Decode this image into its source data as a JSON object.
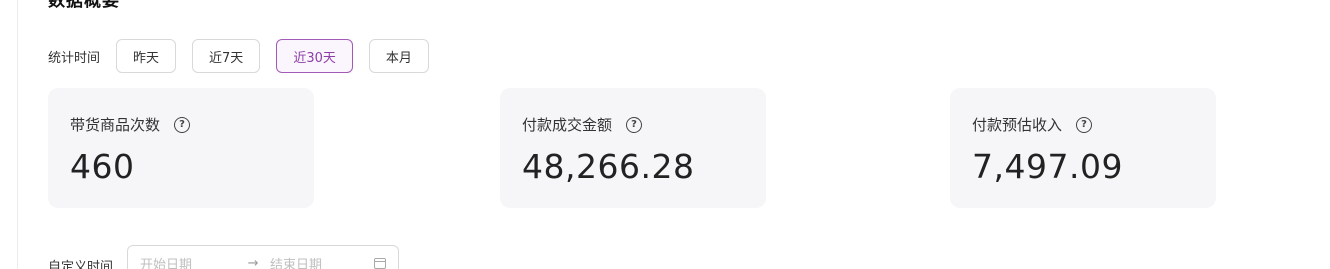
{
  "section": {
    "title": "数据概要"
  },
  "filter": {
    "label": "统计时间",
    "options": [
      "昨天",
      "近7天",
      "近30天",
      "本月"
    ],
    "selected": "近30天"
  },
  "cards": [
    {
      "title": "带货商品次数",
      "value": "460",
      "icon": "question-circle-icon"
    },
    {
      "title": "付款成交金额",
      "value": "48,266.28",
      "icon": "question-circle-icon"
    },
    {
      "title": "付款预估收入",
      "value": "7,497.09",
      "icon": "question-circle-icon"
    }
  ],
  "custom_range": {
    "label": "自定义时间",
    "start_placeholder": "开始日期",
    "separator": "→",
    "end_placeholder": "结束日期",
    "icon": "calendar-icon"
  },
  "colors": {
    "accent": "#8e3ea8",
    "card_bg": "#f6f6f8"
  }
}
